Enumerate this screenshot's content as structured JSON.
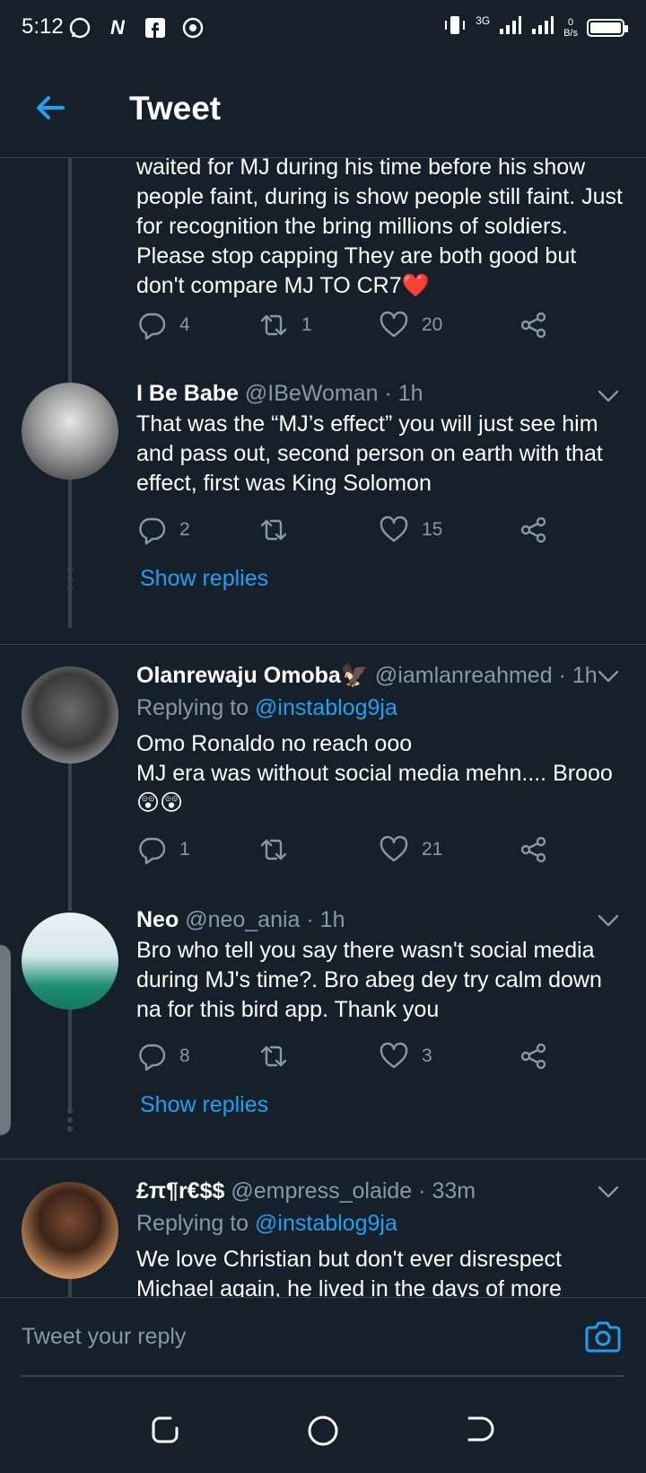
{
  "status_bar": {
    "time": "5:12",
    "network": "3G",
    "speed_value": "0",
    "speed_unit": "B/s"
  },
  "header": {
    "title": "Tweet"
  },
  "tweets": [
    {
      "body": "waited for MJ during his time before his show people faint, during is show people still faint. Just for recognition the bring millions of soldiers. Please stop capping They are both good but don't compare MJ TO CR7❤️",
      "replies": "4",
      "retweets": "1",
      "likes": "20"
    },
    {
      "name": "I Be Babe",
      "handle": "@IBeWoman",
      "time": "· 1h",
      "body": "That was the “MJ’s effect” you will just see him and pass out, second person on earth with that effect, first was King Solomon",
      "replies": "2",
      "retweets": "",
      "likes": "15",
      "show_replies": "Show replies"
    },
    {
      "name": "Olanrewaju Omoba🦅",
      "handle": "@iamlanreahmed",
      "time": "· 1h",
      "replying_prefix": "Replying to",
      "replying_to": "@instablog9ja",
      "body_line1": "Omo Ronaldo no reach ooo",
      "body_line2": "MJ era was without social media mehn.... Brooo 😲😲",
      "replies": "1",
      "retweets": "",
      "likes": "21"
    },
    {
      "name": "Neo",
      "handle": "@neo_ania",
      "time": "· 1h",
      "body": "Bro who tell you say there wasn't social media during MJ's time?. Bro abeg dey try calm down na for this bird app. Thank you",
      "replies": "8",
      "retweets": "",
      "likes": "3",
      "show_replies": "Show replies"
    },
    {
      "name": "£π¶r€$$",
      "handle": "@empress_olaide",
      "time": "· 33m",
      "replying_prefix": "Replying to",
      "replying_to": "@instablog9ja",
      "body": "We love Christian but don't ever disrespect Michael again, he lived in the days of more"
    }
  ],
  "reply_bar": {
    "placeholder": "Tweet your reply"
  },
  "colors": {
    "background": "#15202b",
    "border": "#38444d",
    "secondary_text": "#8899a6",
    "accent": "#1da1f2"
  }
}
